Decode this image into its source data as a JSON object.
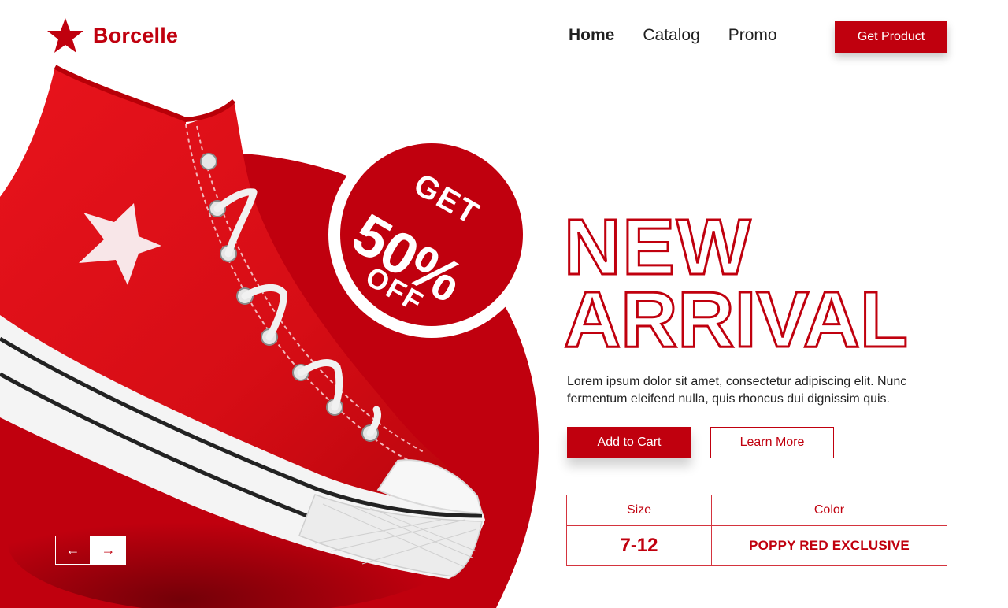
{
  "brand": {
    "name": "Borcelle",
    "logo_icon": "star-icon",
    "color": "#c0000e"
  },
  "nav": {
    "items": [
      "Home",
      "Catalog",
      "Promo"
    ],
    "active": "Home"
  },
  "header": {
    "cta_label": "Get Product"
  },
  "badge": {
    "line1": "GET",
    "line2": "50%",
    "line3": "OFF"
  },
  "hero": {
    "headline_line1": "NEW",
    "headline_line2": "ARRIVAL",
    "description": "Lorem ipsum dolor sit amet, consectetur adipiscing elit. Nunc fermentum eleifend nulla, quis rhoncus dui dignissim quis.",
    "primary_button": "Add to Cart",
    "secondary_button": "Learn More"
  },
  "specs": {
    "headers": [
      "Size",
      "Color"
    ],
    "values": [
      "7-12",
      "POPPY RED EXCLUSIVE"
    ]
  },
  "slider": {
    "prev_icon": "arrow-left-icon",
    "next_icon": "arrow-right-icon",
    "prev_glyph": "←",
    "next_glyph": "→"
  },
  "colors": {
    "accent": "#c0000e",
    "background": "#ffffff",
    "text": "#222222"
  }
}
